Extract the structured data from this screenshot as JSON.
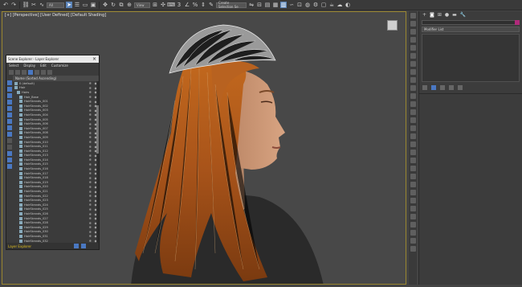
{
  "toolbar": {
    "items": [
      "undo-icon",
      "redo-icon",
      "link-icon",
      "unlink-icon",
      "bind-icon"
    ],
    "selection_filter": "All",
    "view_dropdown": "View",
    "selection_set": "Create Selection Se"
  },
  "viewport": {
    "label": "[+] [Perspective] [User Defined] [Default Shading]"
  },
  "explorer": {
    "title": "Scene Explorer - Layer Explorer",
    "menus": [
      "Select",
      "Display",
      "Edit",
      "Customize"
    ],
    "column_header": "Name (Sorted Ascending)",
    "rows": [
      {
        "name": "0 (default)",
        "indent": 2
      },
      {
        "name": "Hair",
        "indent": 2
      },
      {
        "name": "Hairs",
        "indent": 5
      },
      {
        "name": "Hair_Base",
        "indent": 8
      },
      {
        "name": "HairStrands_001",
        "indent": 8
      },
      {
        "name": "HairStrands_002",
        "indent": 8
      },
      {
        "name": "HairStrands_003",
        "indent": 8
      },
      {
        "name": "HairStrands_004",
        "indent": 8
      },
      {
        "name": "HairStrands_005",
        "indent": 8
      },
      {
        "name": "HairStrands_006",
        "indent": 8
      },
      {
        "name": "HairStrands_007",
        "indent": 8
      },
      {
        "name": "HairStrands_008",
        "indent": 8
      },
      {
        "name": "HairStrands_009",
        "indent": 8
      },
      {
        "name": "HairStrands_010",
        "indent": 8
      },
      {
        "name": "HairStrands_011",
        "indent": 8
      },
      {
        "name": "HairStrands_012",
        "indent": 8
      },
      {
        "name": "HairStrands_013",
        "indent": 8
      },
      {
        "name": "HairStrands_014",
        "indent": 8
      },
      {
        "name": "HairStrands_015",
        "indent": 8
      },
      {
        "name": "HairStrands_016",
        "indent": 8
      },
      {
        "name": "HairStrands_017",
        "indent": 8
      },
      {
        "name": "HairStrands_018",
        "indent": 8
      },
      {
        "name": "HairStrands_019",
        "indent": 8
      },
      {
        "name": "HairStrands_020",
        "indent": 8
      },
      {
        "name": "HairStrands_021",
        "indent": 8
      },
      {
        "name": "HairStrands_022",
        "indent": 8
      },
      {
        "name": "HairStrands_023",
        "indent": 8
      },
      {
        "name": "HairStrands_024",
        "indent": 8
      },
      {
        "name": "HairStrands_025",
        "indent": 8
      },
      {
        "name": "HairStrands_026",
        "indent": 8
      },
      {
        "name": "HairStrands_027",
        "indent": 8
      },
      {
        "name": "HairStrands_028",
        "indent": 8
      },
      {
        "name": "HairStrands_029",
        "indent": 8
      },
      {
        "name": "HairStrands_030",
        "indent": 8
      },
      {
        "name": "HairStrands_031",
        "indent": 8
      },
      {
        "name": "HairStrands_032",
        "indent": 8
      },
      {
        "name": "HairStrands_033",
        "indent": 8
      },
      {
        "name": "HairStrands_034",
        "indent": 8
      }
    ],
    "status": "Layer Explorer"
  },
  "command_panel": {
    "tabs": [
      "create-icon",
      "modify-icon",
      "hierarchy-icon",
      "motion-icon",
      "display-icon",
      "utilities-icon"
    ],
    "name_field": "",
    "modifier_dropdown": "Modifier List",
    "accent_color": "#b02a7a"
  },
  "colors": {
    "viewport_bg": "#484848",
    "viewport_border": "#9a8630",
    "hair": "#b05a16",
    "skin": "#c98f6a",
    "highlight": "#4a78c2"
  }
}
